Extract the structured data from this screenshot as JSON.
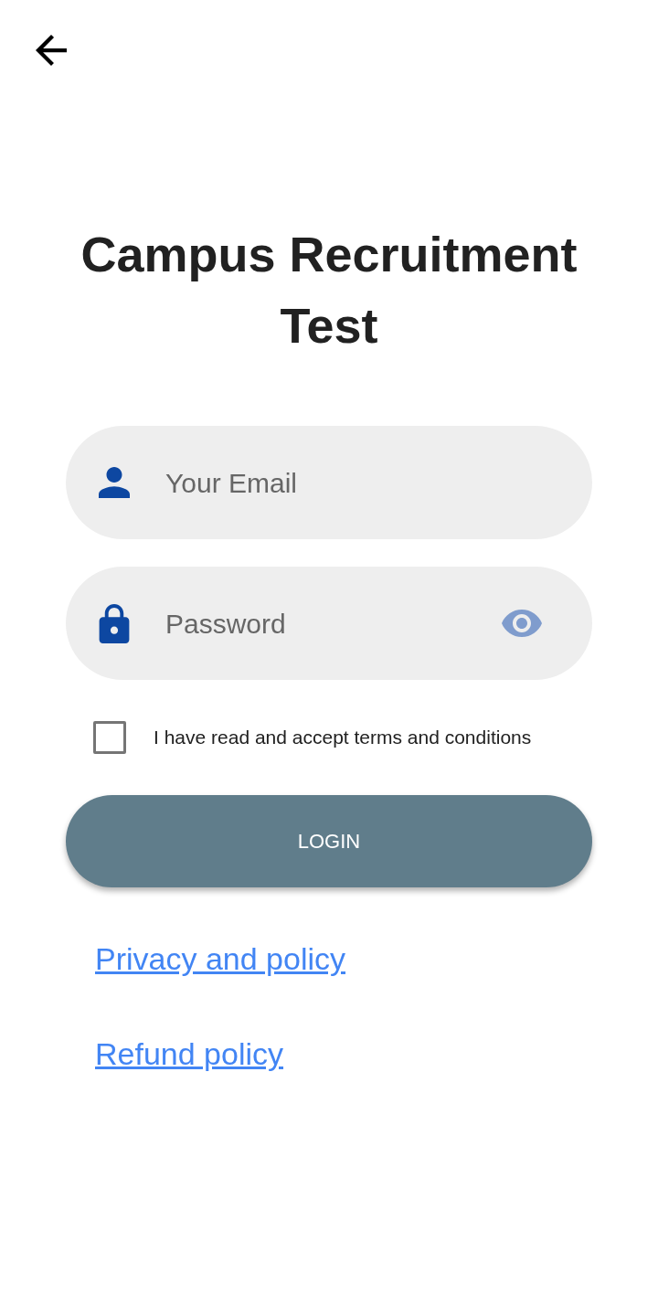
{
  "title": "Campus Recruitment Test",
  "fields": [
    {
      "kind": "email",
      "placeholder": "Your Email"
    },
    {
      "kind": "password",
      "placeholder": "Password"
    }
  ],
  "terms": {
    "label": "I have read and accept terms and conditions",
    "checked": false
  },
  "login_button": {
    "label": "LOGIN"
  },
  "links": [
    "Privacy and policy",
    "Refund policy"
  ]
}
